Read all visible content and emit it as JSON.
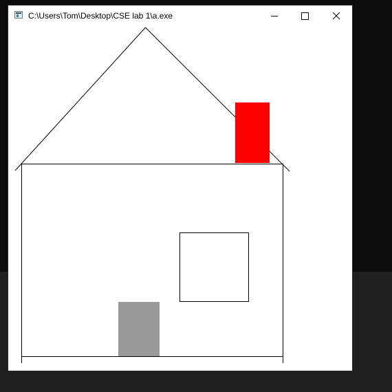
{
  "window": {
    "title": "C:\\Users\\Tom\\Desktop\\CSE lab 1\\a.exe",
    "icon": "console-app-icon",
    "controls": {
      "minimize_icon": "minimize-icon",
      "maximize_icon": "maximize-icon",
      "close_icon": "close-icon"
    }
  },
  "drawing": {
    "background_color": "#ffffff",
    "line_color": "#000000",
    "chimney_color": "#ff0000",
    "door_color": "#999999"
  }
}
